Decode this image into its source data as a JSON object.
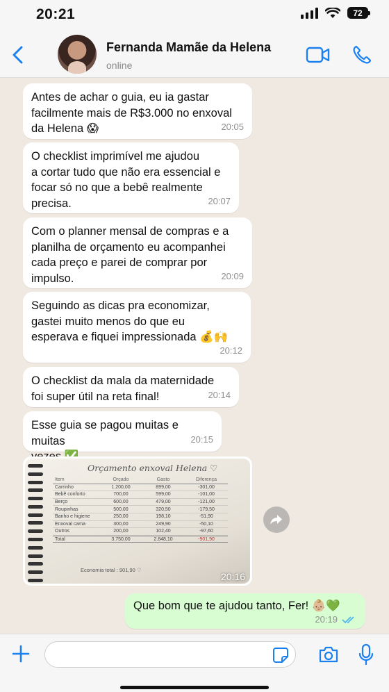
{
  "status_bar": {
    "time": "20:21",
    "battery": "72"
  },
  "header": {
    "contact_name": "Fernanda Mamãe da Helena",
    "status": "online"
  },
  "messages": [
    {
      "text": "Antes de achar o guia, eu ia gastar\nfacilmente mais de R$3.000 no enxoval\nda Helena 😱",
      "time": "20:05"
    },
    {
      "text": "O checklist imprimível me ajudou\na cortar tudo que não era essencial e\nfocar só no que a bebê realmente\nprecisa.",
      "time": "20:07"
    },
    {
      "text": "Com o planner mensal de compras e a\nplanilha de orçamento eu acompanhei\ncada preço e parei de comprar por\nimpulso.",
      "time": "20:09"
    },
    {
      "text": "Seguindo as dicas pra economizar,\ngastei muito menos do que eu\nesperava e fiquei impressionada 💰🙌",
      "time": "20:12"
    },
    {
      "text": "O checklist da mala da maternidade\nfoi super útil na reta final!",
      "time": "20:14"
    },
    {
      "text": "Esse guia se pagou muitas e muitas\nvezes ✅",
      "time": "20:15"
    }
  ],
  "image_message": {
    "time": "20:16",
    "title": "Orçamento enxoval Helena ♡",
    "headers": [
      "Item",
      "Orçado",
      "Gasto",
      "Diferença"
    ],
    "rows": [
      [
        "Carrinho",
        "1.200,00",
        "899,00",
        "-301,00"
      ],
      [
        "Bebê conforto",
        "700,00",
        "599,00",
        "-101,00"
      ],
      [
        "Berço",
        "600,00",
        "479,00",
        "-121,00"
      ],
      [
        "Roupinhas",
        "500,00",
        "320,50",
        "-179,50"
      ],
      [
        "Banho e higiene",
        "250,00",
        "198,10",
        "-51,90"
      ],
      [
        "Enxoval cama",
        "300,00",
        "249,90",
        "-50,10"
      ],
      [
        "Outros",
        "200,00",
        "102,40",
        "-97,60"
      ]
    ],
    "total": [
      "Total",
      "3.750,00",
      "2.848,10",
      "-901,90"
    ],
    "economy": "Economia total : 901,90 ♡"
  },
  "outgoing": {
    "text": "Que bom que te ajudou tanto, Fer! 👶🏼💚",
    "time": "20:19"
  },
  "footer": {
    "input_value": "",
    "input_placeholder": ""
  },
  "colors": {
    "accent": "#1a80f0",
    "outgoing_bubble": "#d9fdd3",
    "incoming_bubble": "#ffffff",
    "background": "#efe9e1"
  }
}
